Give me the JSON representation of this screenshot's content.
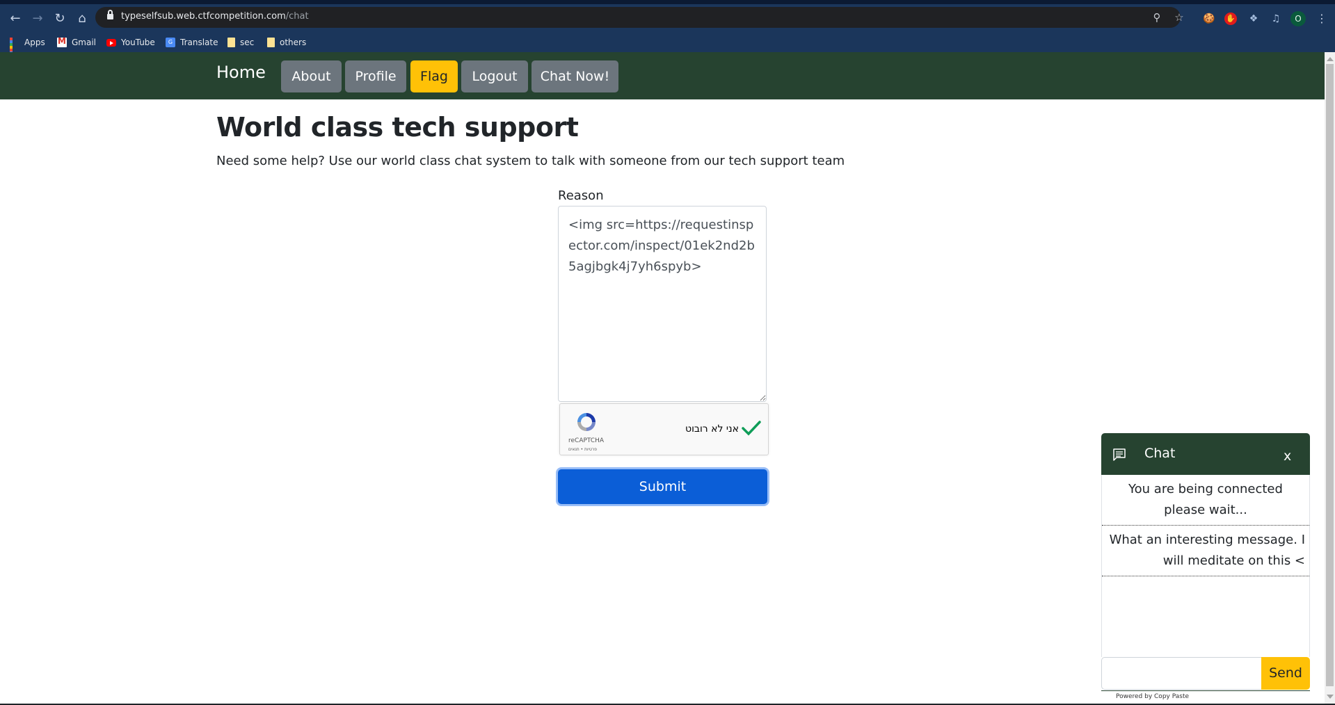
{
  "browser": {
    "url_host": "typeselfsub.web.ctfcompetition.com",
    "url_path": "/chat",
    "nav": {
      "back_icon": "arrow-left-icon",
      "forward_icon": "arrow-right-icon",
      "reload_icon": "reload-icon",
      "home_icon": "home-icon"
    },
    "omnibox_icons": [
      "zoom-out-icon",
      "star-icon"
    ],
    "extensions": [
      "cookie-icon",
      "adblock-hand-icon",
      "puzzle-icon",
      "media-queue-icon"
    ],
    "profile_initial": "O",
    "bookmarks": [
      {
        "label": "Apps",
        "icon": "apps-grid-icon"
      },
      {
        "label": "Gmail",
        "icon": "gmail-icon"
      },
      {
        "label": "YouTube",
        "icon": "youtube-icon"
      },
      {
        "label": "Translate",
        "icon": "translate-icon"
      },
      {
        "label": "sec",
        "icon": "folder-icon"
      },
      {
        "label": "others",
        "icon": "folder-icon"
      }
    ]
  },
  "navbar": {
    "brand": "Home",
    "buttons": [
      {
        "label": "About"
      },
      {
        "label": "Profile"
      },
      {
        "label": "Flag"
      },
      {
        "label": "Logout"
      },
      {
        "label": "Chat Now!"
      }
    ],
    "colors": {
      "bg": "#264330",
      "button": "#6c757d",
      "flag": "#ffc107"
    }
  },
  "main": {
    "title": "World class tech support",
    "subtitle": "Need some help? Use our world class chat system to talk with someone from our tech support team",
    "form": {
      "reason_label": "Reason",
      "reason_value": "<img src=https://requestinspector.com/inspect/01ek2nd2b5agjbgk4j7yh6spyb>",
      "captcha": {
        "label": "אני לא רובוט",
        "brand": "reCAPTCHA",
        "links": "פרטיות • תנאים",
        "checked": true
      },
      "submit_label": "Submit",
      "submit_color": "#0b5ed7"
    }
  },
  "chat": {
    "title": "Chat",
    "close_label": "x",
    "messages": [
      {
        "text": "You are being connected please wait..."
      },
      {
        "text": "What an interesting message. I will meditate on this <"
      }
    ],
    "input_value": "",
    "send_label": "Send",
    "footer": "Powered by Copy Paste"
  }
}
